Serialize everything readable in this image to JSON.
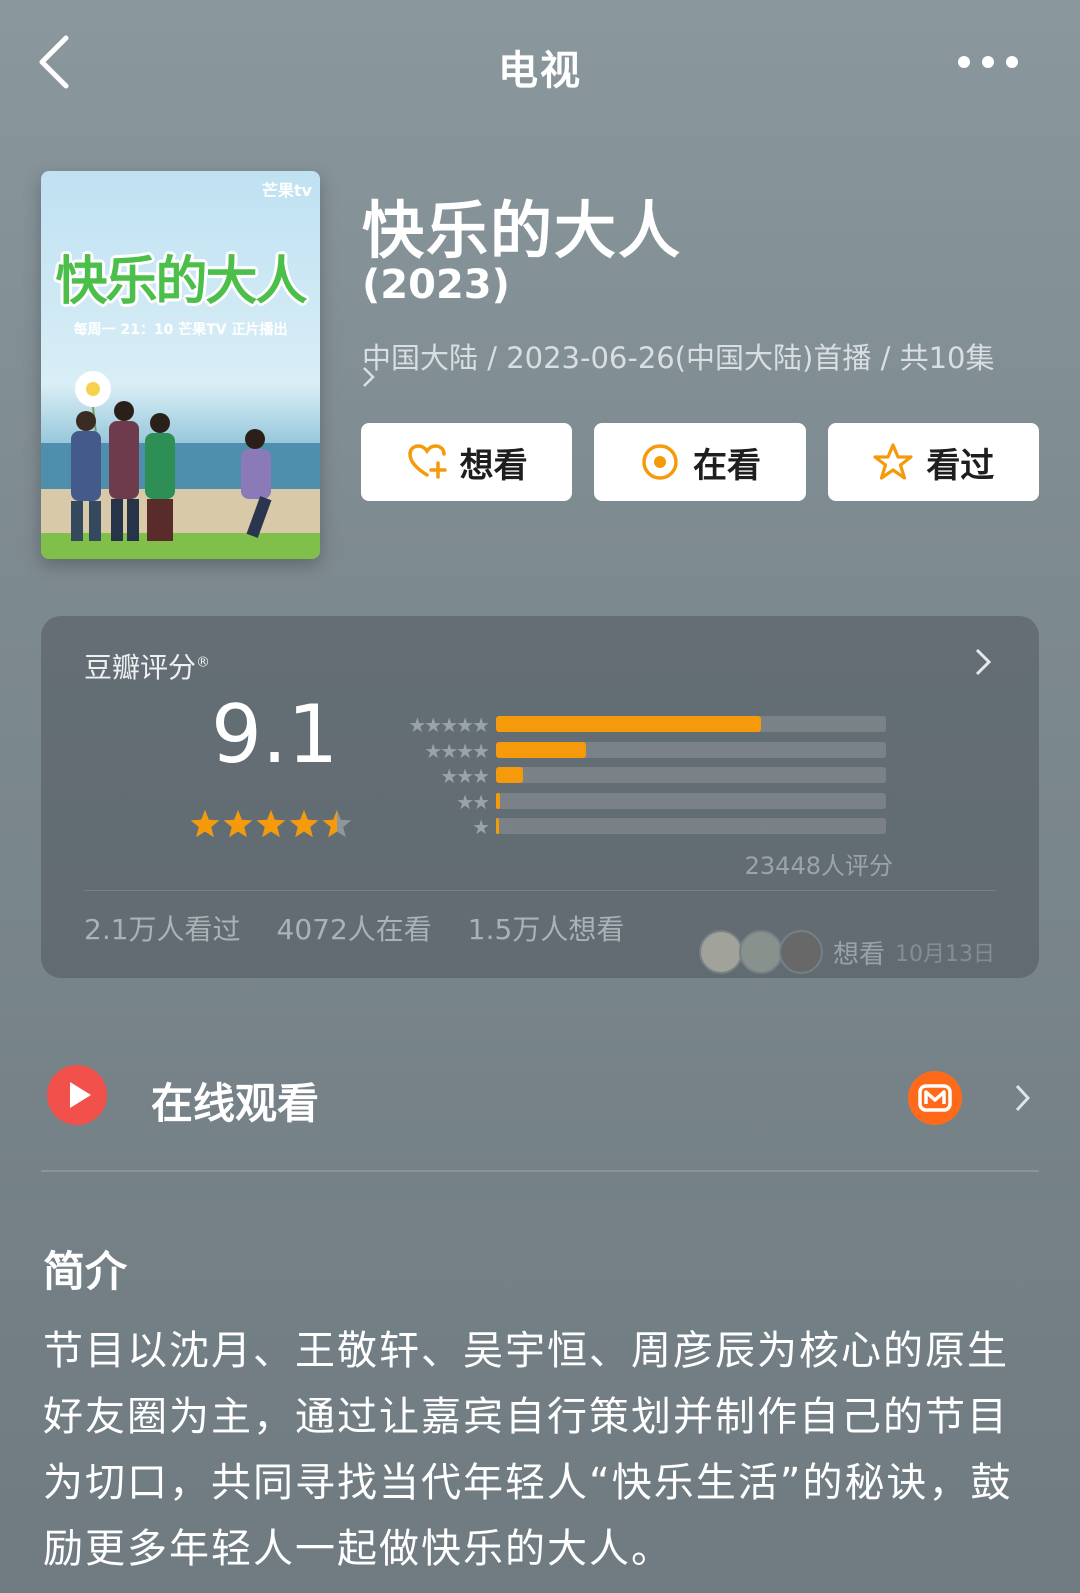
{
  "topbar": {
    "title": "电视"
  },
  "show": {
    "title": "快乐的大人",
    "year": "(2023)",
    "meta": "中国大陆 / 2023-06-26(中国大陆)首播 / 共10集",
    "poster": {
      "badge": "芒果tv",
      "title_art": "快乐的大人",
      "tagline": "每周一 21：10 芒果TV 正片播出"
    }
  },
  "actions": [
    {
      "label": "想看",
      "icon": "heart-plus-icon",
      "color": "#f59a0a"
    },
    {
      "label": "在看",
      "icon": "target-icon",
      "color": "#f59a0a"
    },
    {
      "label": "看过",
      "icon": "star-outline-icon",
      "color": "#f59a0a"
    }
  ],
  "rating": {
    "source": "豆瓣评分",
    "registered_mark": "®",
    "score": "9.1",
    "stars": 4.5,
    "distribution": [
      {
        "stars": 5,
        "fraction": 0.68
      },
      {
        "stars": 4,
        "fraction": 0.23
      },
      {
        "stars": 3,
        "fraction": 0.07
      },
      {
        "stars": 2,
        "fraction": 0.01
      },
      {
        "stars": 1,
        "fraction": 0.005
      }
    ],
    "count_text": "23448人评分",
    "stats": [
      "2.1万人看过",
      "4072人在看",
      "1.5万人想看"
    ],
    "friend_activity": {
      "action": "想看",
      "date": "10月13日"
    },
    "accent_color": "#f59a0a"
  },
  "watch": {
    "label": "在线观看",
    "provider_icon": "mango-tv-logo"
  },
  "intro": {
    "title": "简介",
    "body": "节目以沈月、王敬轩、吴宇恒、周彦辰为核心的原生好友圈为主，通过让嘉宾自行策划并制作自己的节目为切口，共同寻找当代年轻人“快乐生活”的秘诀，鼓励更多年轻人一起做快乐的大人。"
  }
}
